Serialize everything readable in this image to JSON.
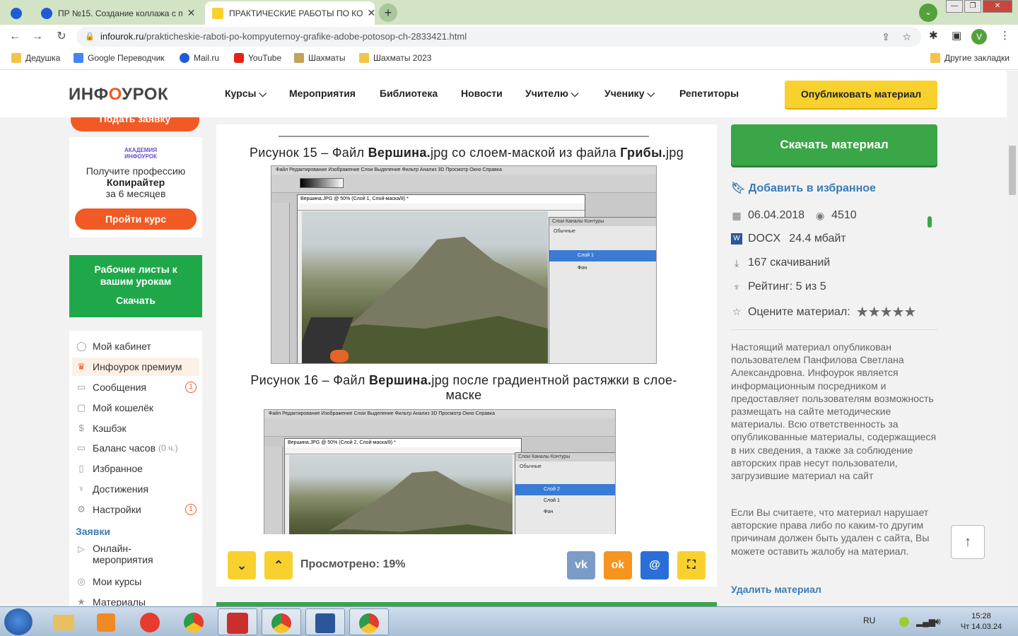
{
  "browser": {
    "tabs": [
      {
        "title": ""
      },
      {
        "title": "ПР №15. Создание коллажа с п"
      },
      {
        "title": "ПРАКТИЧЕСКИЕ РАБОТЫ ПО КО"
      }
    ],
    "new_tab": "+",
    "url_host": "infourok.ru",
    "url_path": "/prakticheskie-raboti-po-kompyuternoy-grafike-adobe-potosop-ch-2833421.html",
    "profile_initial": "V",
    "bookmarks": [
      {
        "label": "Дедушка",
        "icon": "folder-icon"
      },
      {
        "label": "Google Переводчик",
        "icon": "google-translate-icon"
      },
      {
        "label": "Mail.ru",
        "icon": "mailru-icon"
      },
      {
        "label": "YouTube",
        "icon": "youtube-icon"
      },
      {
        "label": "Шахматы",
        "icon": "chess-icon"
      },
      {
        "label": "Шахматы 2023",
        "icon": "folder-icon"
      }
    ],
    "other_bookmarks": "Другие закладки"
  },
  "site": {
    "logo_part1": "ИНФ",
    "logo_part2": "О",
    "logo_part3": "УРОК",
    "menu": [
      "Курсы",
      "Мероприятия",
      "Библиотека",
      "Новости",
      "Учителю",
      "Ученику",
      "Репетиторы"
    ],
    "publish": "Опубликовать материал"
  },
  "left": {
    "apply": "Подать заявку",
    "promo_logo": "АКАДЕМИЯ ИНФОУРОК",
    "promo_line1": "Получите профессию",
    "promo_line2": "Копирайтер",
    "promo_line3": "за 6 месяцев",
    "promo_button": "Пройти курс",
    "worksheets_title": "Рабочие листы к вашим урокам",
    "worksheets_button": "Скачать",
    "nav": [
      {
        "label": "Мой кабинет",
        "icon": "user-icon"
      },
      {
        "label": "Инфоурок премиум",
        "icon": "crown-icon"
      },
      {
        "label": "Сообщения",
        "icon": "message-icon",
        "count": "1"
      },
      {
        "label": "Мой кошелёк",
        "icon": "wallet-icon"
      },
      {
        "label": "Кэшбэк",
        "icon": "cashback-icon"
      },
      {
        "label": "Баланс часов",
        "icon": "clock-icon",
        "sub": "(0 ч.)"
      },
      {
        "label": "Избранное",
        "icon": "bookmark-icon"
      },
      {
        "label": "Достижения",
        "icon": "trophy-icon"
      },
      {
        "label": "Настройки",
        "icon": "gear-icon",
        "count": "1"
      }
    ],
    "section_title": "Заявки",
    "nav2": [
      {
        "label": "Онлайн-мероприятия",
        "icon": "play-icon"
      },
      {
        "label": "Мои курсы",
        "icon": "courses-icon"
      },
      {
        "label": "Материалы",
        "icon": "star-icon"
      }
    ]
  },
  "doc": {
    "caption15": {
      "pre": "Рисунок 15 – Файл ",
      "b1": "Вершина.",
      "mid": "jpg со слоем-маской из файла ",
      "b2": "Грибы.",
      "post": "jpg"
    },
    "caption16": {
      "pre": "Рисунок 16 – Файл ",
      "b1": "Вершина.",
      "post": "jpg после градиентной растяжки в слое-маске"
    },
    "ps_menu": "Файл  Редактирование  Изображение  Слои  Выделение  Фильтр  Анализ  3D  Просмотр  Окно  Справка",
    "ps_doc1": "Вершина.JPG @ 50% (Слой 1, Слой-маска/8) *",
    "ps_doc2": "Вершина.JPG @ 50% (Слой 2, Слой-маска/8) *",
    "ps_layers_tabs": "Слои  Каналы  Контуры",
    "ps_blend": "Обычные",
    "layers1": [
      "Слой 1",
      "Фон"
    ],
    "layers2": [
      "Слой 2",
      "Слой 1",
      "Фон"
    ],
    "viewed": "Просмотрено: 19%",
    "share": {
      "vk": "vk",
      "ok": "ok",
      "mail": "@"
    }
  },
  "right": {
    "download": "Скачать материал",
    "favorite": "Добавить в избранное",
    "date": "06.04.2018",
    "views": "4510",
    "format": "DOCX",
    "size": "24.4 мбайт",
    "downloads": "167 скачиваний",
    "rating": "Рейтинг: 5 из 5",
    "rate_label": "Оцените материал:",
    "stars": "★★★★★",
    "disclaimer": "Настоящий материал опубликован пользователем Панфилова Светлана Александровна. Инфоурок является информационным посредником и предоставляет пользователям возможность размещать на сайте методические материалы. Всю ответственность за опубликованные материалы, содержащиеся в них сведения, а также за соблюдение авторских прав несут пользователи, загрузившие материал на сайт",
    "complaint": "Если Вы считаете, что материал нарушает авторские права либо по каким-то другим причинам должен быть удален с сайта, Вы можете оставить жалобу на материал.",
    "delete": "Удалить материал"
  },
  "taskbar": {
    "lang": "RU",
    "time": "15:28",
    "date": "Чт 14.03.24"
  },
  "colors": {
    "green": "#3aa648",
    "orange": "#f15a24",
    "yellow": "#f8d12f",
    "link": "#3a7bb5"
  }
}
